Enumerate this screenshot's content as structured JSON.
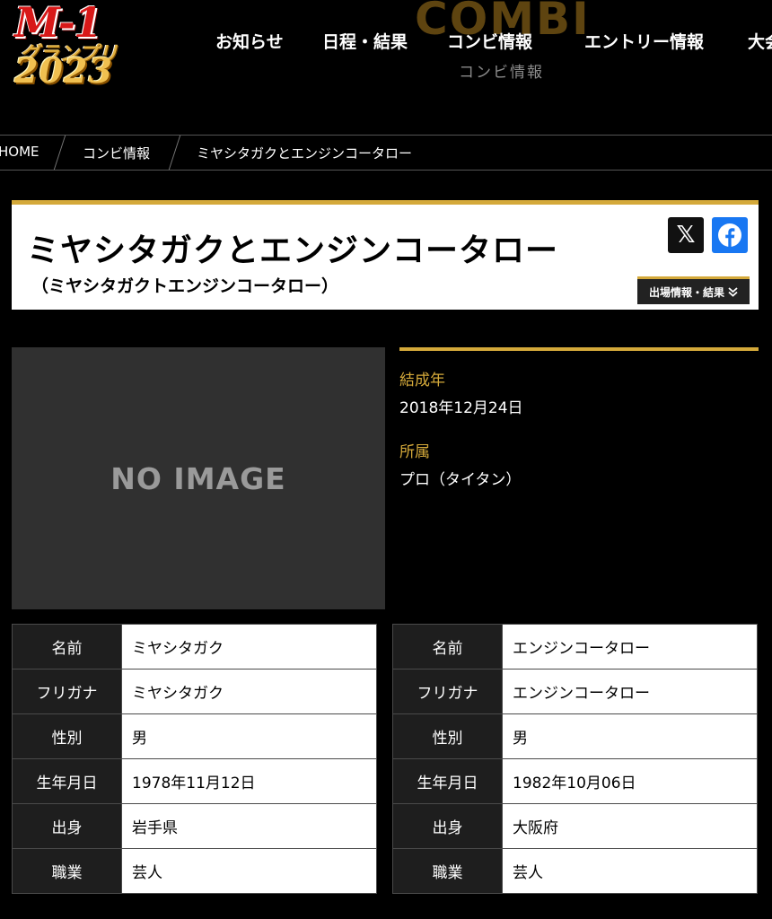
{
  "logo": {
    "line1": "M-1",
    "line2": "グランプリ",
    "line3": "2023"
  },
  "nav": {
    "items": [
      "お知らせ",
      "日程・結果",
      "コンビ情報",
      "エントリー情報",
      "大会"
    ],
    "section_bg": "COMBI",
    "section_sub": "コンビ情報"
  },
  "breadcrumb": [
    "HOME",
    "コンビ情報",
    "ミヤシタガクとエンジンコータロー"
  ],
  "combi": {
    "name": "ミヤシタガクとエンジンコータロー",
    "kana": "（ミヤシタガクトエンジンコータロー）"
  },
  "share": {
    "x_icon": "x-logo-icon",
    "facebook_icon": "facebook-icon"
  },
  "results_button": "出場情報・結果",
  "photo": {
    "placeholder": "NO IMAGE"
  },
  "info": [
    {
      "label": "結成年",
      "value": "2018年12月24日"
    },
    {
      "label": "所属",
      "value": "プロ（タイタン）"
    }
  ],
  "members": [
    {
      "rows": [
        {
          "key": "名前",
          "value": "ミヤシタガク"
        },
        {
          "key": "フリガナ",
          "value": "ミヤシタガク"
        },
        {
          "key": "性別",
          "value": "男"
        },
        {
          "key": "生年月日",
          "value": "1978年11月12日"
        },
        {
          "key": "出身",
          "value": "岩手県"
        },
        {
          "key": "職業",
          "value": "芸人"
        }
      ]
    },
    {
      "rows": [
        {
          "key": "名前",
          "value": "エンジンコータロー"
        },
        {
          "key": "フリガナ",
          "value": "エンジンコータロー"
        },
        {
          "key": "性別",
          "value": "男"
        },
        {
          "key": "生年月日",
          "value": "1982年10月06日"
        },
        {
          "key": "出身",
          "value": "大阪府"
        },
        {
          "key": "職業",
          "value": "芸人"
        }
      ]
    }
  ],
  "colors": {
    "accent_gold": "#d4a93a",
    "facebook_blue": "#1877f2"
  }
}
